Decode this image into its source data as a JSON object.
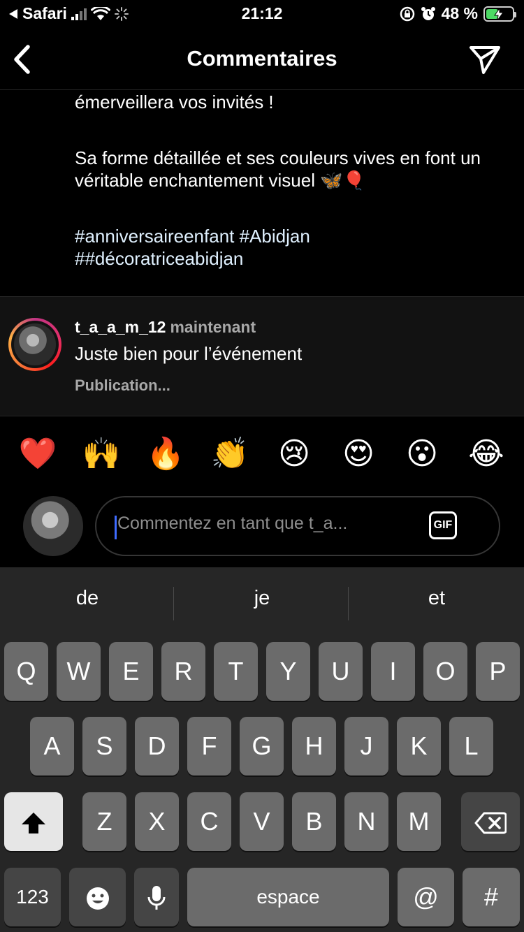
{
  "status_bar": {
    "back_app": "Safari",
    "time": "21:12",
    "battery_percent": "48 %",
    "battery_level": 0.48,
    "icons": [
      "back-arrow-icon",
      "signal-icon",
      "wifi-icon",
      "activity-spinner-icon",
      "orientation-lock-icon",
      "alarm-icon",
      "battery-icon",
      "charging-bolt-icon"
    ]
  },
  "header": {
    "title": "Commentaires",
    "back_icon": "chevron-left-icon",
    "send_icon": "paper-plane-icon"
  },
  "caption": {
    "line1": "émerveillera vos invités !",
    "paragraph2": "Sa forme détaillée et ses couleurs vives en font un véritable enchantement visuel 🦋🎈",
    "hashtags_line1": "#anniversaireenfant #Abidjan",
    "hashtags_line2": "##décoratriceabidjan"
  },
  "comment": {
    "username": "t_a_a_m_12",
    "time": "maintenant",
    "text": "Juste bien pour l’événement",
    "status": "Publication..."
  },
  "emoji_reactions": [
    "❤️",
    "🙌",
    "🔥",
    "👏",
    "😢",
    "😍",
    "😮",
    "😂"
  ],
  "composer": {
    "placeholder": "Commentez en tant que t_a...",
    "value": "",
    "gif_label": "GIF"
  },
  "keyboard": {
    "suggestions": [
      "de",
      "je",
      "et"
    ],
    "row1": [
      "Q",
      "W",
      "E",
      "R",
      "T",
      "Y",
      "U",
      "I",
      "O",
      "P"
    ],
    "row2": [
      "A",
      "S",
      "D",
      "F",
      "G",
      "H",
      "J",
      "K",
      "L"
    ],
    "row3": [
      "Z",
      "X",
      "C",
      "V",
      "B",
      "N",
      "M"
    ],
    "numbers_label": "123",
    "space_label": "espace",
    "at_label": "@",
    "hash_label": "#"
  },
  "colors": {
    "background": "#000000",
    "comment_bg": "#121212",
    "hashtag": "#e0f1ff",
    "keyboard_bg": "#262626",
    "key_bg": "#6b6b6b",
    "battery_green": "#4cd964",
    "caret_blue": "#3f6cff"
  }
}
